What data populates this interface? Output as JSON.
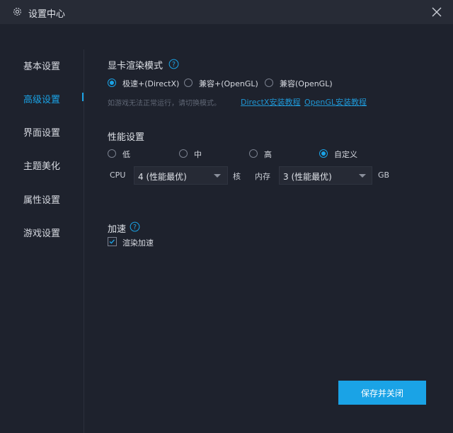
{
  "window": {
    "title": "设置中心"
  },
  "sidebar": {
    "items": [
      {
        "label": "基本设置"
      },
      {
        "label": "高级设置",
        "active": true
      },
      {
        "label": "界面设置"
      },
      {
        "label": "主题美化"
      },
      {
        "label": "属性设置"
      },
      {
        "label": "游戏设置"
      }
    ]
  },
  "render_mode": {
    "title": "显卡渲染模式",
    "options": [
      {
        "label": "极速+(DirectX)",
        "selected": true
      },
      {
        "label": "兼容+(OpenGL)",
        "selected": false
      },
      {
        "label": "兼容(OpenGL)",
        "selected": false
      }
    ],
    "hint": "如游戏无法正常运行，请切换模式。",
    "links": [
      "DirectX安装教程",
      "OpenGL安装教程"
    ]
  },
  "performance": {
    "title": "性能设置",
    "options": [
      {
        "label": "低",
        "selected": false
      },
      {
        "label": "中",
        "selected": false
      },
      {
        "label": "高",
        "selected": false
      },
      {
        "label": "自定义",
        "selected": true
      }
    ],
    "cpu_label": "CPU",
    "cpu_value": "4 (性能最优)",
    "cpu_unit": "核",
    "memory_label": "内存",
    "memory_value": "3 (性能最优)",
    "memory_unit": "GB"
  },
  "acceleration": {
    "title": "加速",
    "render_accel_label": "渲染加速",
    "render_accel_checked": true
  },
  "footer": {
    "save_label": "保存并关闭"
  },
  "colors": {
    "accent": "#1aa3e6",
    "background": "#1e222d",
    "titlebar": "#272b36"
  }
}
